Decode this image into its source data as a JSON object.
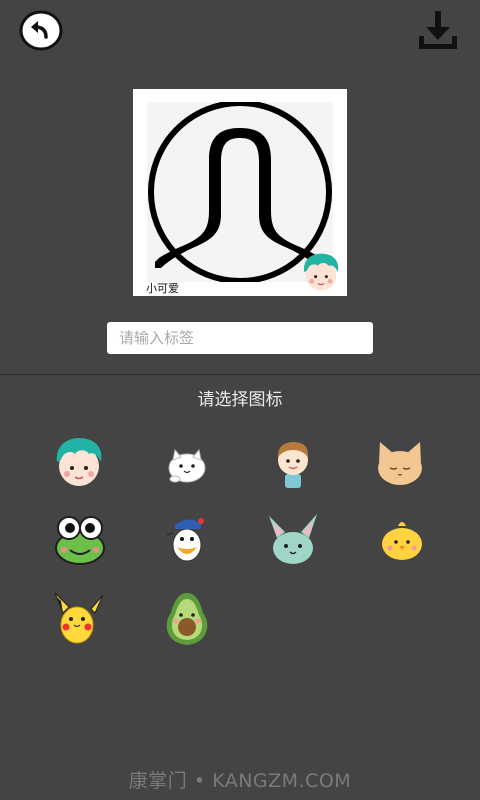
{
  "toolbar": {
    "back_icon": "back-arrow-icon",
    "download_icon": "download-icon"
  },
  "preview": {
    "caption": "小可爱",
    "avatar_icon": "default-avatar-icon",
    "sticker_icon": "teal-hair-boy-sticker"
  },
  "tag_input": {
    "placeholder": "请输入标签",
    "value": ""
  },
  "icon_section": {
    "title": "请选择图标",
    "icons": [
      {
        "name": "teal-hair-boy-icon"
      },
      {
        "name": "white-cat-icon"
      },
      {
        "name": "cartoon-boy-icon"
      },
      {
        "name": "sleepy-cat-icon"
      },
      {
        "name": "keroppi-frog-icon"
      },
      {
        "name": "donald-duck-icon"
      },
      {
        "name": "bunny-icon"
      },
      {
        "name": "yellow-chick-icon"
      },
      {
        "name": "pikachu-icon"
      },
      {
        "name": "avocado-icon"
      }
    ]
  },
  "watermark": "康掌门 • KANGZM.COM",
  "colors": {
    "background": "#444444",
    "divider": "#2c2c2c",
    "input_bg": "#ffffff",
    "placeholder": "#a8a8a8"
  }
}
